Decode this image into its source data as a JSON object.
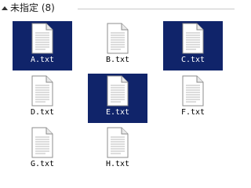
{
  "group": {
    "title": "未指定 (8)"
  },
  "colors": {
    "selection": "#10246a",
    "selected_text": "#ffffff",
    "text": "#000000",
    "rule": "#c9c9c9"
  },
  "files": [
    {
      "name": "A.txt",
      "icon": "text-file-icon",
      "selected": true
    },
    {
      "name": "B.txt",
      "icon": "text-file-icon",
      "selected": false
    },
    {
      "name": "C.txt",
      "icon": "text-file-icon",
      "selected": true
    },
    {
      "name": "D.txt",
      "icon": "text-file-icon",
      "selected": false
    },
    {
      "name": "E.txt",
      "icon": "text-file-icon",
      "selected": true
    },
    {
      "name": "F.txt",
      "icon": "text-file-icon",
      "selected": false
    },
    {
      "name": "G.txt",
      "icon": "text-file-icon",
      "selected": false
    },
    {
      "name": "H.txt",
      "icon": "text-file-icon",
      "selected": false
    }
  ]
}
